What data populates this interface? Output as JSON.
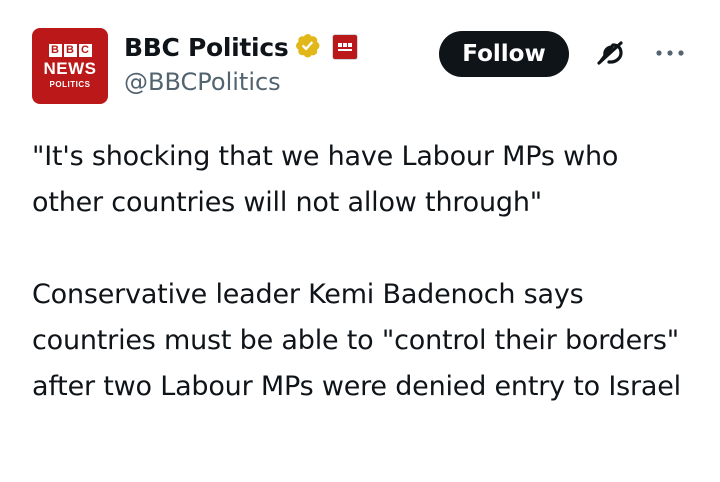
{
  "author": {
    "avatar": {
      "bbc_letters": [
        "B",
        "B",
        "C"
      ],
      "line1": "NEWS",
      "line2": "POLITICS",
      "background": "#bb1919"
    },
    "display_name": "BBC Politics",
    "handle": "@BBCPolitics",
    "verified_badge_color": "#e2b719",
    "affiliate_badge": "bbc-news-badge"
  },
  "actions": {
    "follow_label": "Follow",
    "grok_icon": "grok-icon",
    "more_icon": "more-options-icon"
  },
  "tweet": {
    "paragraphs": [
      "\"It's shocking that we have Labour MPs who other countries will not allow through\"",
      "Conservative leader Kemi Badenoch says countries must be able to \"control their borders\" after two Labour MPs were denied entry to Israel"
    ]
  }
}
